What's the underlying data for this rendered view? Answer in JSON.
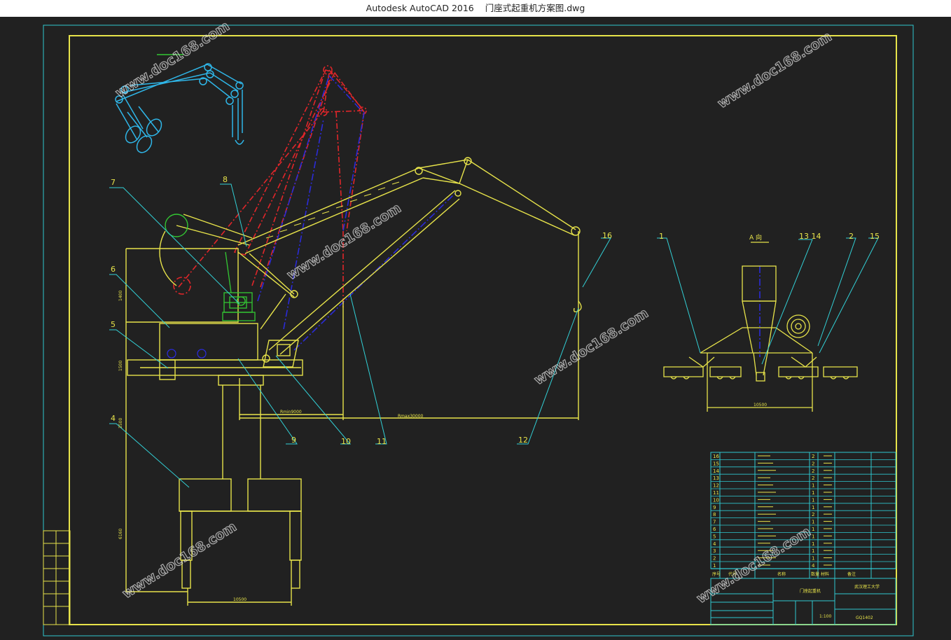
{
  "window": {
    "app_name": "Autodesk AutoCAD 2016",
    "file_name": "门座式起重机方案图.dwg"
  },
  "colors": {
    "background": "#212121",
    "frame": "#2fc7cf",
    "border": "#e7e34a",
    "ghost_boom": "#e0262a",
    "boom_axis": "#2b2bd8",
    "green": "#33c833",
    "leader": "#32d0d6"
  },
  "callouts": [
    {
      "id": "1",
      "label": "1"
    },
    {
      "id": "2",
      "label": "2"
    },
    {
      "id": "4",
      "label": "4"
    },
    {
      "id": "5",
      "label": "5"
    },
    {
      "id": "6",
      "label": "6"
    },
    {
      "id": "7",
      "label": "7"
    },
    {
      "id": "8",
      "label": "8"
    },
    {
      "id": "9",
      "label": "9"
    },
    {
      "id": "10",
      "label": "10"
    },
    {
      "id": "11",
      "label": "11"
    },
    {
      "id": "12",
      "label": "12"
    },
    {
      "id": "13_14",
      "label": "13 14"
    },
    {
      "id": "15",
      "label": "15"
    },
    {
      "id": "16",
      "label": "16"
    }
  ],
  "dimensions": {
    "rmin": "Rmin9000",
    "rmax": "Rmax30000",
    "base_width": "10500",
    "side_width": "10500",
    "view_label": "A 向",
    "height_top": "1400",
    "height_mid": "3500",
    "height_low": "6160",
    "height_base": "1500"
  },
  "bom": {
    "rows": [
      {
        "no": "16",
        "qty": "2"
      },
      {
        "no": "15",
        "qty": "2"
      },
      {
        "no": "14",
        "qty": "2"
      },
      {
        "no": "13",
        "qty": "2"
      },
      {
        "no": "12",
        "qty": "1"
      },
      {
        "no": "11",
        "qty": "1"
      },
      {
        "no": "10",
        "qty": "1"
      },
      {
        "no": "9",
        "qty": "1"
      },
      {
        "no": "8",
        "qty": "2"
      },
      {
        "no": "7",
        "qty": "1"
      },
      {
        "no": "6",
        "qty": "1"
      },
      {
        "no": "5",
        "qty": "1"
      },
      {
        "no": "4",
        "qty": "1"
      },
      {
        "no": "3",
        "qty": "1"
      },
      {
        "no": "2",
        "qty": "1"
      },
      {
        "no": "1",
        "qty": "4"
      }
    ],
    "header": {
      "no": "序号",
      "code": "代号",
      "name": "名称",
      "qty": "数量",
      "material": "材料",
      "note": "备注"
    }
  },
  "title_block": {
    "drawing_name": "门座起重机",
    "scale": "1:100",
    "drawing_no": "GQ1402",
    "school": "武汉理工大学"
  },
  "watermark": "www.doc168.com"
}
